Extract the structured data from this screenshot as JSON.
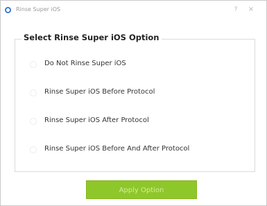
{
  "window": {
    "title": "Rinse Super iOS",
    "help_glyph": "?",
    "close_glyph": "×"
  },
  "group": {
    "title": "Select Rinse Super iOS Option"
  },
  "options": [
    {
      "label": "Do Not Rinse Super iOS",
      "selected": false
    },
    {
      "label": "Rinse Super iOS Before Protocol",
      "selected": false
    },
    {
      "label": "Rinse Super iOS After Protocol",
      "selected": false
    },
    {
      "label": "Rinse Super iOS Before And After Protocol",
      "selected": false
    }
  ],
  "actions": {
    "apply_label": "Apply Option"
  },
  "colors": {
    "accent_green": "#8ec72a",
    "app_icon_blue": "#2c6fd4"
  },
  "icons": {
    "app": "app-icon",
    "help": "help-icon",
    "close": "close-icon"
  }
}
